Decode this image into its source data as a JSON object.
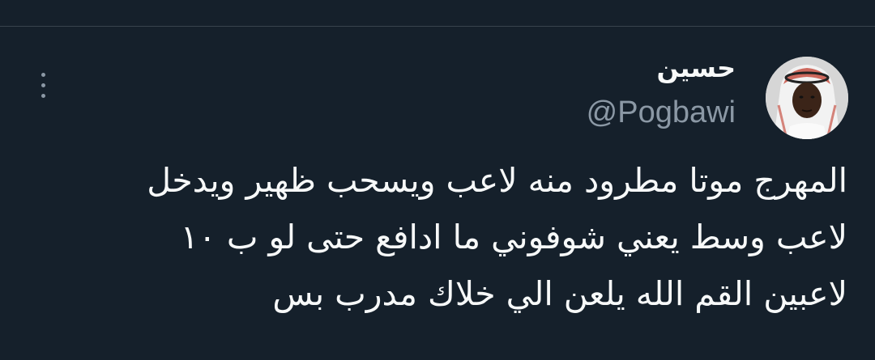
{
  "tweet": {
    "author": {
      "display_name": "حسين",
      "handle": "@Pogbawi",
      "avatar_icon": "avatar-photo"
    },
    "more_icon": "more-vertical-icon",
    "text_lines": [
      "المهرج موتا مطرود منه لاعب ويسحب ظهير ويدخل",
      "لاعب وسط يعني شوفوني ما ادافع حتى لو ب ١٠",
      "لاعبين القم الله يلعن الي خلاك مدرب بس"
    ]
  },
  "colors": {
    "background": "#15202b",
    "text_primary": "#f7f9f9",
    "text_secondary": "#8b98a5",
    "divider": "#38444d"
  }
}
